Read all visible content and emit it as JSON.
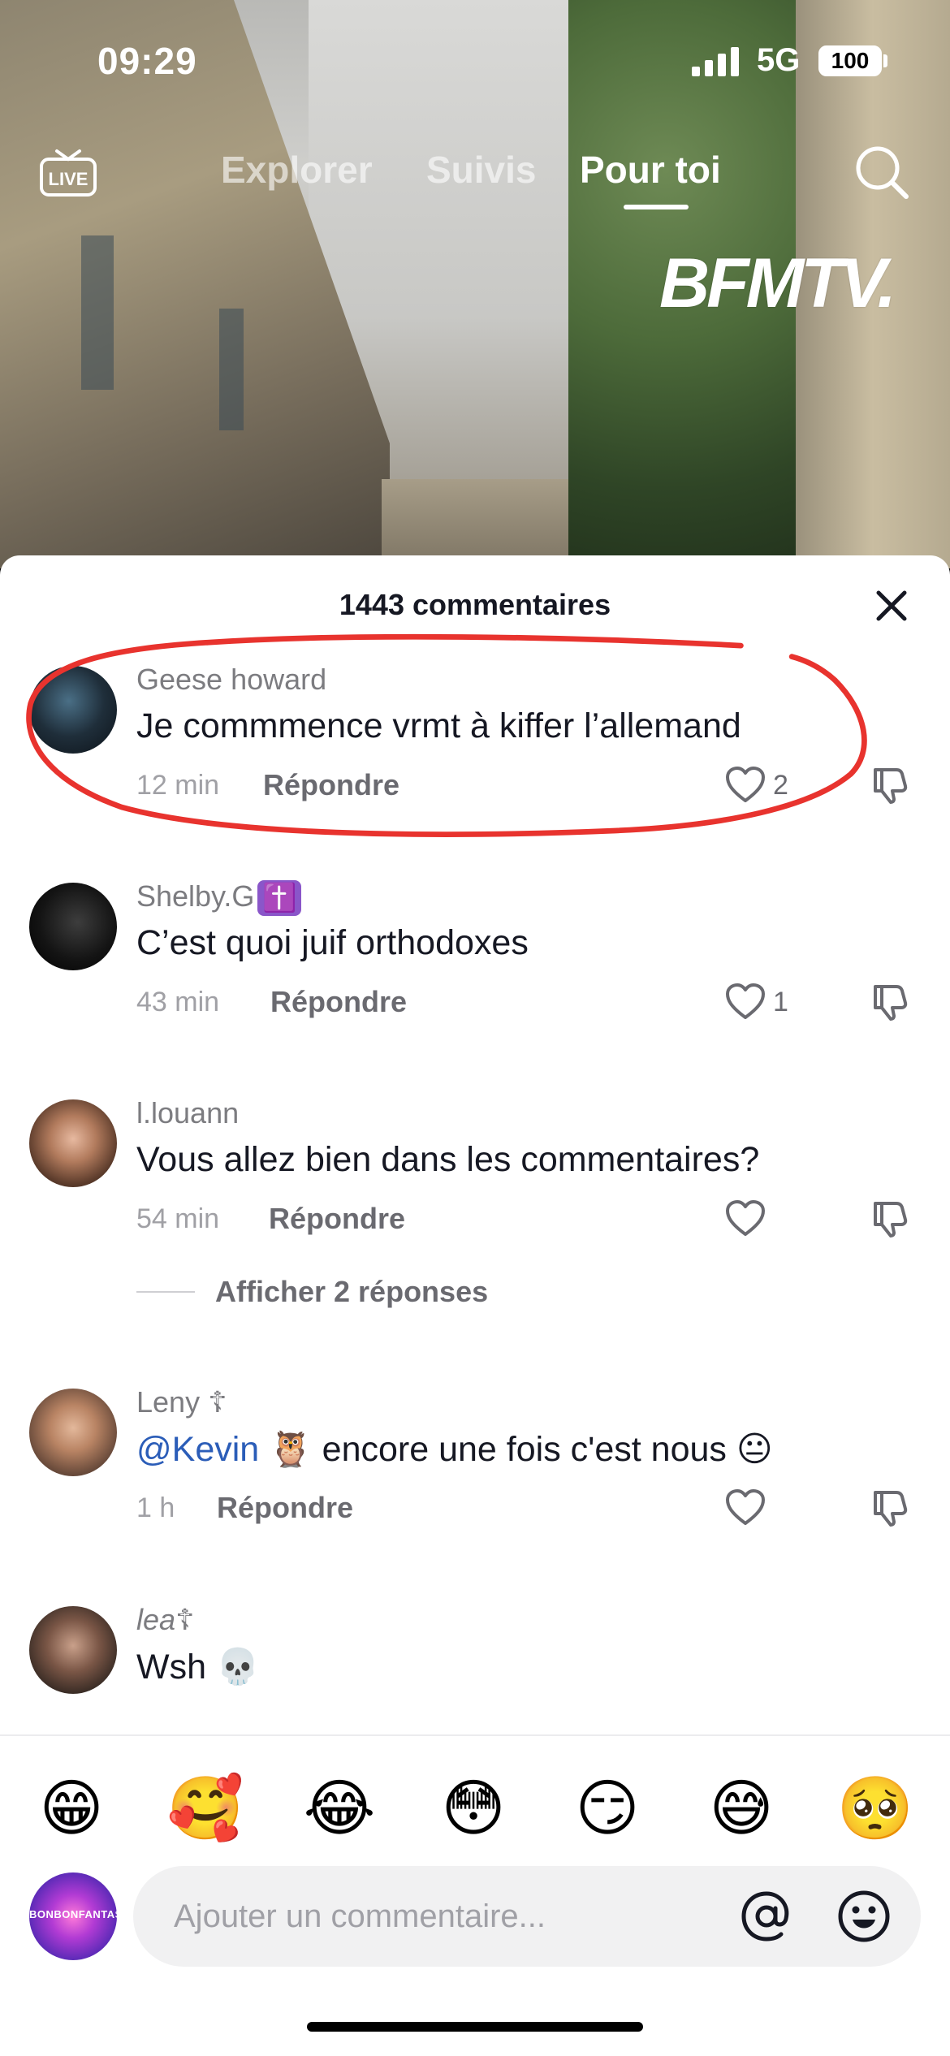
{
  "status_bar": {
    "time": "09:29",
    "network": "5G",
    "battery": "100"
  },
  "top_nav": {
    "tabs": [
      {
        "label": "Explorer"
      },
      {
        "label": "Suivis"
      },
      {
        "label": "Pour toi"
      }
    ],
    "active_tab": "Pour toi",
    "live_label": "LIVE",
    "brand_logo": "BFMTV."
  },
  "comments_sheet": {
    "title": "1443 commentaires",
    "comments": [
      {
        "user": "Geese howard",
        "text": "Je commmence vrmt à kiffer l’allemand",
        "time": "12 min",
        "reply": "Répondre",
        "likes": "2"
      },
      {
        "user": "Shelby.G",
        "badge": "✝️",
        "text": "C’est quoi juif orthodoxes",
        "time": "43 min",
        "reply": "Répondre",
        "likes": "1"
      },
      {
        "user": "l.louann",
        "text": "Vous allez bien dans les commentaires?",
        "time": "54 min",
        "reply": "Répondre",
        "likes": "",
        "replies_label": "Afficher 2 réponses"
      },
      {
        "user": "Leny ☦",
        "mention": "@Kevin",
        "text_emoji": "🦉",
        "text": "encore une fois c'est nous",
        "text_end_emoji": "😐",
        "time": "1 h",
        "reply": "Répondre",
        "likes": ""
      },
      {
        "user": "lea☦",
        "text": "Wsh 💀"
      }
    ]
  },
  "emoji_bar": [
    "😁",
    "🥰",
    "😂",
    "😳",
    "😏",
    "😅",
    "🥺"
  ],
  "composer": {
    "placeholder": "Ajouter un commentaire...",
    "avatar_text": "BONBONFANTASY"
  },
  "colors": {
    "highlight_circle": "#e8332e",
    "mention": "#2b5db8",
    "badge": "#8a56c9"
  }
}
